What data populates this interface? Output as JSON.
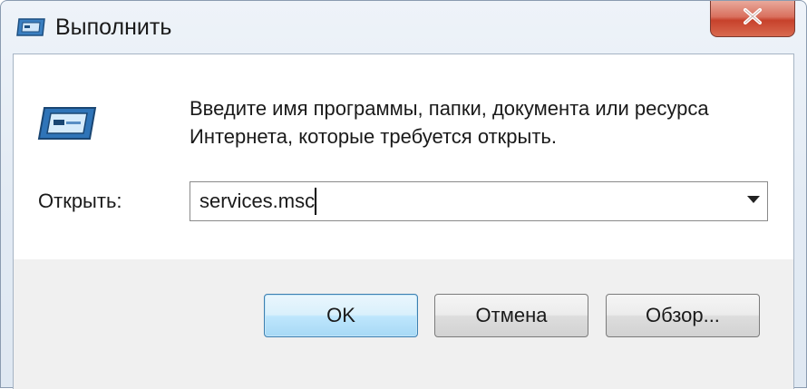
{
  "window": {
    "title": "Выполнить",
    "title_icon": "run-dialog-icon",
    "close_icon": "close-icon"
  },
  "dialog": {
    "icon": "run-app-icon",
    "description": "Введите имя программы, папки, документа или ресурса Интернета, которые требуется открыть.",
    "open_label": "Открыть:",
    "open_value": "services.msc",
    "dropdown_icon": "chevron-down-icon"
  },
  "buttons": {
    "ok": "OK",
    "cancel": "Отмена",
    "browse": "Обзор..."
  },
  "colors": {
    "close_button": "#c7412b",
    "default_button_border": "#3c7fb1"
  }
}
